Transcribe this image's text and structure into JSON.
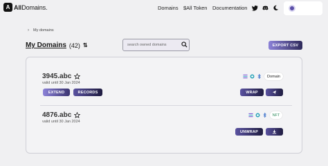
{
  "header": {
    "logo_mark": "A",
    "logo_bold": "All",
    "logo_rest": "Domains.",
    "nav": [
      "Domains",
      "$All Token",
      "Documentation"
    ],
    "icons": [
      "twitter-icon",
      "discord-icon",
      "theme-toggle-icon",
      "wallet-avatar-icon"
    ]
  },
  "breadcrumb": {
    "label": "My domains"
  },
  "page": {
    "title": "My Domains",
    "count": "(42)",
    "search_placeholder": "search owned domains",
    "export_label": "EXPORT CSV"
  },
  "domains": [
    {
      "name": "3945.abc",
      "valid": "valid until 30 Jan 2024",
      "tag": "Domain",
      "actions": [
        "EXTEND",
        "RECORDS"
      ],
      "right_action": "WRAP"
    },
    {
      "name": "4876.abc",
      "valid": "valid until 30 Jan 2024",
      "tag": "NFT",
      "right_action": "UNWRAP"
    }
  ],
  "colors": {
    "accent_light": "#8c82d8",
    "accent_dark": "#1f1c40",
    "background": "#f0f0f2"
  }
}
